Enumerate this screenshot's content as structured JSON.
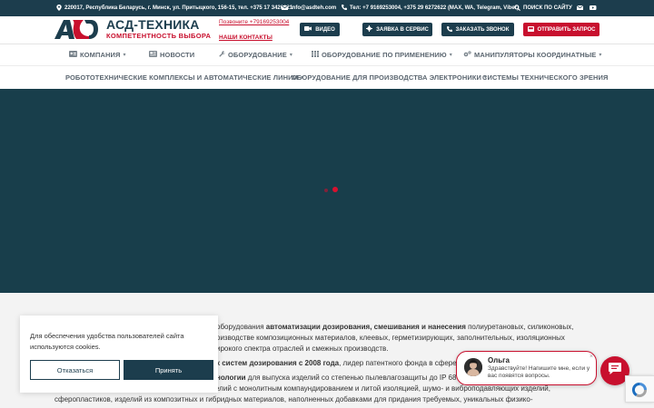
{
  "topbar": {
    "address": "220017, Республика Беларусь, г. Минск, ул. Притыцкого, 156-15, тел. +375 17 3420121",
    "email": "info@asdteh.com",
    "phones": "Тел: +7 9169253004, +375 29 6272622 (MAX, WA, Telegram, Viber)",
    "search_label": "ПОИСК ПО САЙТУ",
    "colors": {
      "bg": "#1c3d4d"
    }
  },
  "header": {
    "logo_title": "АСД-ТЕХНИКА",
    "logo_subtitle": "КОМПЕТЕНТНОСТЬ ВЫБОРА",
    "phone_link": "Позвоните +79169253004",
    "contacts_link": "НАШИ КОНТАКТЫ",
    "buttons": {
      "video": "ВИДЕО",
      "service": "ЗАЯВКА В СЕРВИС",
      "callback": "ЗАКАЗАТЬ ЗВОНОК",
      "request": "ОТПРАВИТЬ ЗАПРОС"
    },
    "colors": {
      "brand_dark": "#1c3d4d",
      "brand_red": "#c8102e"
    }
  },
  "nav": {
    "row1": [
      "КОМПАНИЯ",
      "НОВОСТИ",
      "ОБОРУДОВАНИЕ",
      "ОБОРУДОВАНИЕ ПО ПРИМЕНЕНИЮ",
      "МАНИПУЛЯТОРЫ КООРДИНАТНЫЕ"
    ],
    "row2": [
      "РОБОТОТЕХНИЧЕСКИЕ КОМПЛЕКСЫ И АВТОМАТИЧЕСКИЕ ЛИНИИ",
      "ОБОРУДОВАНИЕ ДЛЯ ПРОИЗВОДСТВА ЭЛЕКТРОНИКИ",
      "СИСТЕМЫ ТЕХНИЧЕСКОГО ЗРЕНИЯ"
    ]
  },
  "hero": {
    "bg_color": "#183e4b"
  },
  "content": {
    "line1_pre": "оборудования ",
    "line1_bold": "автоматизации дозирования, смешивания и нанесения",
    "line1_post": " полиуретановых, силиконовых,",
    "line2": "оизводстве композиционных материалов, клеевых, герметизирующих, заполнительных, изоляционных",
    "line3": "ирокого спектра отраслей и смежных производств.",
    "line4_bold": "к систем дозирования с 2008 года",
    "line4_post": ", лидер патентного фонда в сфере д",
    "line5_bold": "нологии",
    "line5_post": " для выпуска изделий со степенью пылевлагозащиты до IP 68",
    "line6": "электротехнических изделий, производство изделий с монолитным компаундированием и литой изоляцией, шумо- и виброподавляющих изделий,",
    "line7": "сферопластиков, изделий из композитных и гибридных материалов, наполненных добавками для придания требуемых, уникальных физико-"
  },
  "cookie": {
    "text": "Для обеспечения удобства пользователей сайта используются cookies.",
    "decline": "Отказаться",
    "accept": "Принять"
  },
  "chat": {
    "name": "Ольга",
    "message": "Здравствуйте! Напишите мне, если у вас появятся вопросы."
  }
}
